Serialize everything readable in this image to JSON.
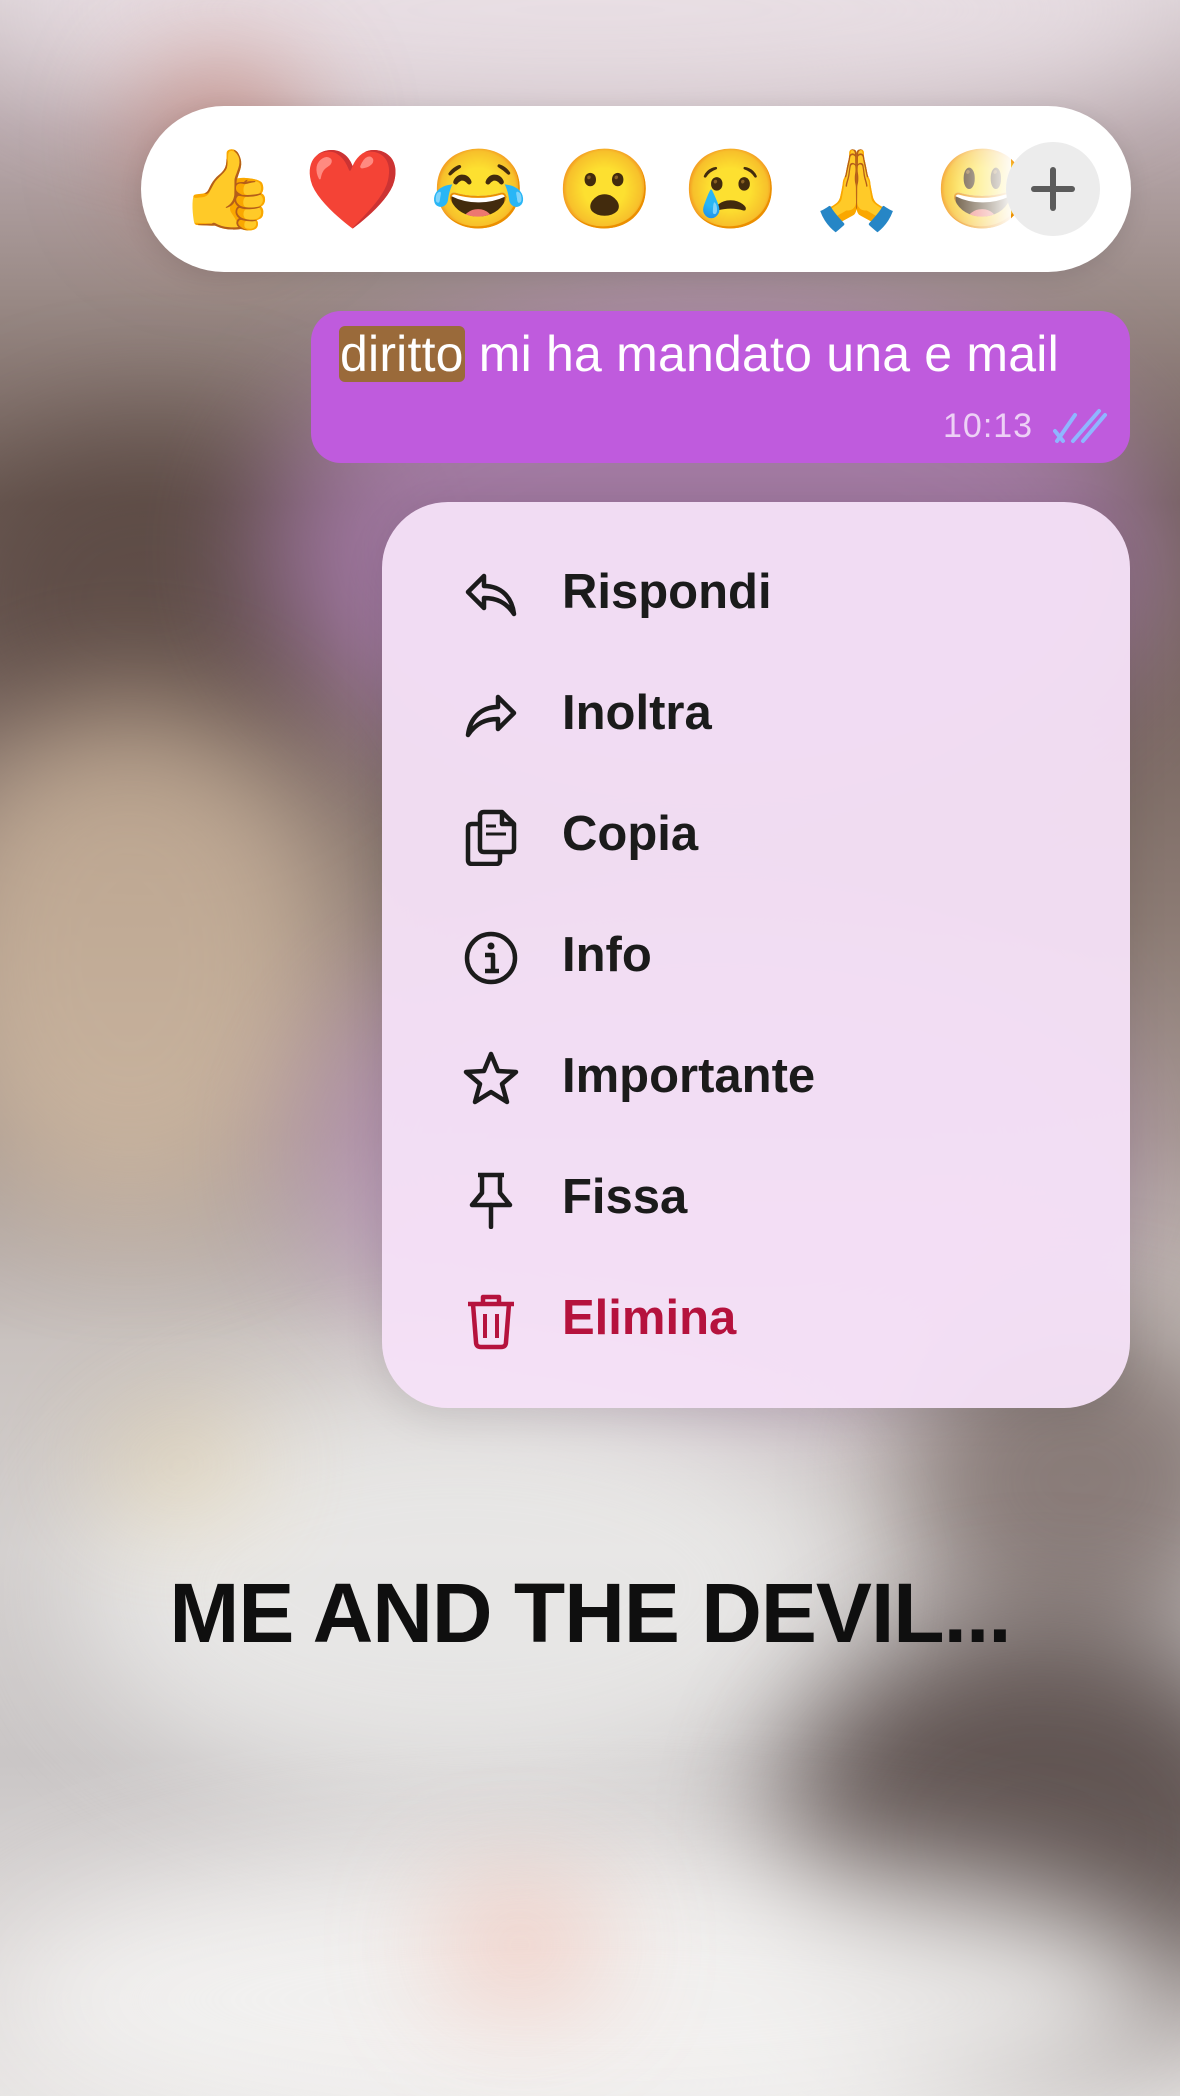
{
  "reactions": {
    "emojis": [
      "👍",
      "❤️",
      "😂",
      "😮",
      "😢",
      "🙏",
      "😃"
    ],
    "more_label": "+"
  },
  "message": {
    "highlighted_word": "diritto",
    "rest_text": " mi ha mandato una e mail",
    "time": "10:13",
    "bubble_color": "#bf5bdd",
    "ticks_color": "#8fb6ff"
  },
  "menu": {
    "items": [
      {
        "label": "Rispondi",
        "icon": "reply-icon"
      },
      {
        "label": "Inoltra",
        "icon": "forward-icon"
      },
      {
        "label": "Copia",
        "icon": "copy-icon"
      },
      {
        "label": "Info",
        "icon": "info-icon"
      },
      {
        "label": "Importante",
        "icon": "star-icon"
      },
      {
        "label": "Fissa",
        "icon": "pin-icon"
      },
      {
        "label": "Elimina",
        "icon": "trash-icon"
      }
    ],
    "danger_color": "#b5123d"
  },
  "caption": "ME AND THE DEVIL..."
}
